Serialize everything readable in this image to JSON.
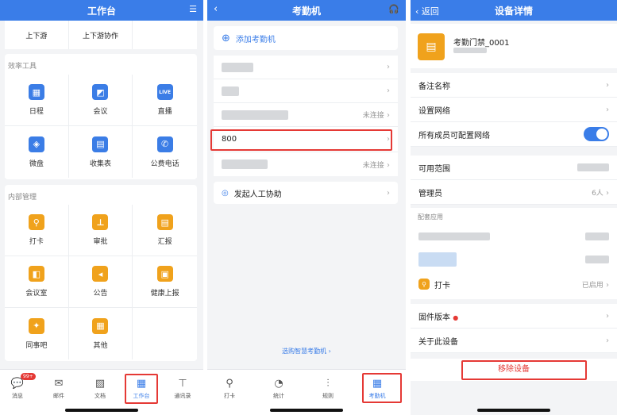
{
  "p1": {
    "title": "工作台",
    "top_items": [
      "上下游",
      "上下游协作"
    ],
    "section1": "效率工具",
    "tools": [
      {
        "label": "日程",
        "icon": "calendar-icon",
        "glyph": "▦"
      },
      {
        "label": "会议",
        "icon": "meeting-icon",
        "glyph": "◩"
      },
      {
        "label": "直播",
        "icon": "live-icon",
        "glyph": "LIVE"
      },
      {
        "label": "微盘",
        "icon": "disk-icon",
        "glyph": "◈"
      },
      {
        "label": "收集表",
        "icon": "form-icon",
        "glyph": "▤"
      },
      {
        "label": "公费电话",
        "icon": "phone-icon",
        "glyph": "✆"
      }
    ],
    "section2": "内部管理",
    "mgmt": [
      {
        "label": "打卡",
        "icon": "checkin-icon",
        "glyph": "⚲"
      },
      {
        "label": "审批",
        "icon": "approval-icon",
        "glyph": "⊥"
      },
      {
        "label": "汇报",
        "icon": "report-icon",
        "glyph": "▤"
      },
      {
        "label": "会议室",
        "icon": "room-icon",
        "glyph": "◧"
      },
      {
        "label": "公告",
        "icon": "notice-icon",
        "glyph": "◂"
      },
      {
        "label": "健康上报",
        "icon": "health-icon",
        "glyph": "▣"
      },
      {
        "label": "同事吧",
        "icon": "colleague-icon",
        "glyph": "✦"
      },
      {
        "label": "其他",
        "icon": "other-icon",
        "glyph": "▦"
      }
    ],
    "tabs": [
      {
        "label": "消息",
        "icon": "message-icon",
        "glyph": "💬",
        "badge": "99+"
      },
      {
        "label": "邮件",
        "icon": "mail-icon",
        "glyph": "✉"
      },
      {
        "label": "文档",
        "icon": "doc-icon",
        "glyph": "▨"
      },
      {
        "label": "工作台",
        "icon": "workbench-icon",
        "glyph": "▦"
      },
      {
        "label": "通讯录",
        "icon": "contacts-icon",
        "glyph": "⊤"
      }
    ]
  },
  "p2": {
    "title": "考勤机",
    "add": "添加考勤机",
    "device": "800",
    "status": "未连接",
    "assist": "发起人工协助",
    "footer_link": "选购智慧考勤机 ›",
    "tabs": [
      "打卡",
      "统计",
      "规则",
      "考勤机"
    ]
  },
  "p3": {
    "back": "返回",
    "title": "设备详情",
    "device_name": "考勤门禁_0001",
    "remark": "备注名称",
    "network": "设置网络",
    "all_config": "所有成员可配置网络",
    "toggle_on": true,
    "range": "可用范围",
    "admin": "管理员",
    "admin_count": "6人",
    "apps_section": "配套应用",
    "checkin": "打卡",
    "checkin_status": "已启用",
    "firmware": "固件版本",
    "about": "关于此设备",
    "remove": "移除设备"
  },
  "colors": {
    "accent": "#3a7de8",
    "danger": "#e53935",
    "orange": "#f0a21c"
  }
}
